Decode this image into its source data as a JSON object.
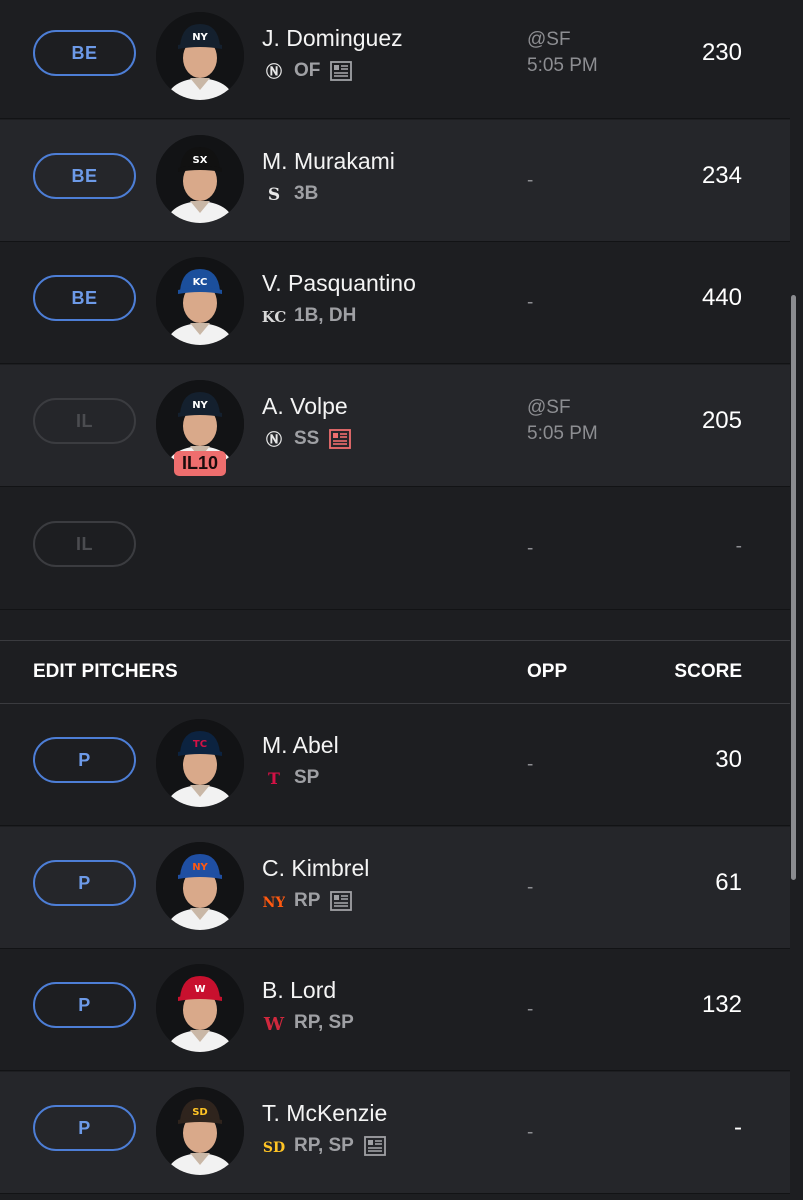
{
  "batters": [
    {
      "slot": "BE",
      "slot_active": true,
      "name": "J. Dominguez",
      "team": "NYY",
      "positions": "OF",
      "news": true,
      "il_badge": "",
      "opp_line1": "@SF",
      "opp_line2": "5:05 PM",
      "score": "230",
      "hat": "#14202e",
      "hat_logo": "NY",
      "logo_color": "#ffffff"
    },
    {
      "slot": "BE",
      "slot_active": true,
      "name": "M. Murakami",
      "team": "CWS",
      "positions": "3B",
      "news": false,
      "il_badge": "",
      "opp_line1": "-",
      "opp_line2": "",
      "score": "234",
      "hat": "#111111",
      "hat_logo": "SX",
      "logo_color": "#ffffff"
    },
    {
      "slot": "BE",
      "slot_active": true,
      "name": "V. Pasquantino",
      "team": "KC",
      "positions": "1B, DH",
      "news": false,
      "il_badge": "",
      "opp_line1": "-",
      "opp_line2": "",
      "score": "440",
      "hat": "#1b4f9c",
      "hat_logo": "KC",
      "logo_color": "#ffffff"
    },
    {
      "slot": "IL",
      "slot_active": false,
      "name": "A. Volpe",
      "team": "NYY",
      "positions": "SS",
      "news": true,
      "news_alert": true,
      "il_badge": "IL10",
      "opp_line1": "@SF",
      "opp_line2": "5:05 PM",
      "score": "205",
      "hat": "#14202e",
      "hat_logo": "NY",
      "logo_color": "#ffffff"
    },
    {
      "slot": "IL",
      "slot_active": false,
      "name": "",
      "team": "",
      "positions": "",
      "news": false,
      "il_badge": "",
      "opp_line1": "-",
      "opp_line2": "",
      "score": "-",
      "empty": true
    }
  ],
  "pitchers_header": {
    "title": "EDIT PITCHERS",
    "opp": "OPP",
    "score": "SCORE"
  },
  "pitchers": [
    {
      "slot": "P",
      "slot_active": true,
      "name": "M. Abel",
      "team": "MIN",
      "positions": "SP",
      "news": false,
      "opp_line1": "-",
      "score": "30",
      "hat": "#0c2340",
      "hat_logo": "TC",
      "logo_color": "#d31145"
    },
    {
      "slot": "P",
      "slot_active": true,
      "name": "C. Kimbrel",
      "team": "NYM",
      "positions": "RP",
      "news": true,
      "opp_line1": "-",
      "score": "61",
      "hat": "#1f4fa3",
      "hat_logo": "NY",
      "logo_color": "#ff5910"
    },
    {
      "slot": "P",
      "slot_active": true,
      "name": "B. Lord",
      "team": "WSH",
      "positions": "RP, SP",
      "news": false,
      "opp_line1": "-",
      "score": "132",
      "hat": "#c8102e",
      "hat_logo": "W",
      "logo_color": "#ffffff"
    },
    {
      "slot": "P",
      "slot_active": true,
      "name": "T. McKenzie",
      "team": "SD",
      "positions": "RP, SP",
      "news": true,
      "opp_line1": "-",
      "score": "-",
      "hat": "#2f241d",
      "hat_logo": "SD",
      "logo_color": "#ffc425"
    }
  ],
  "colors": {
    "accent": "#4d7ed6",
    "il_badge": "#ee6e6e",
    "bg_dark": "#1d1e21",
    "bg_light": "#25262a"
  }
}
